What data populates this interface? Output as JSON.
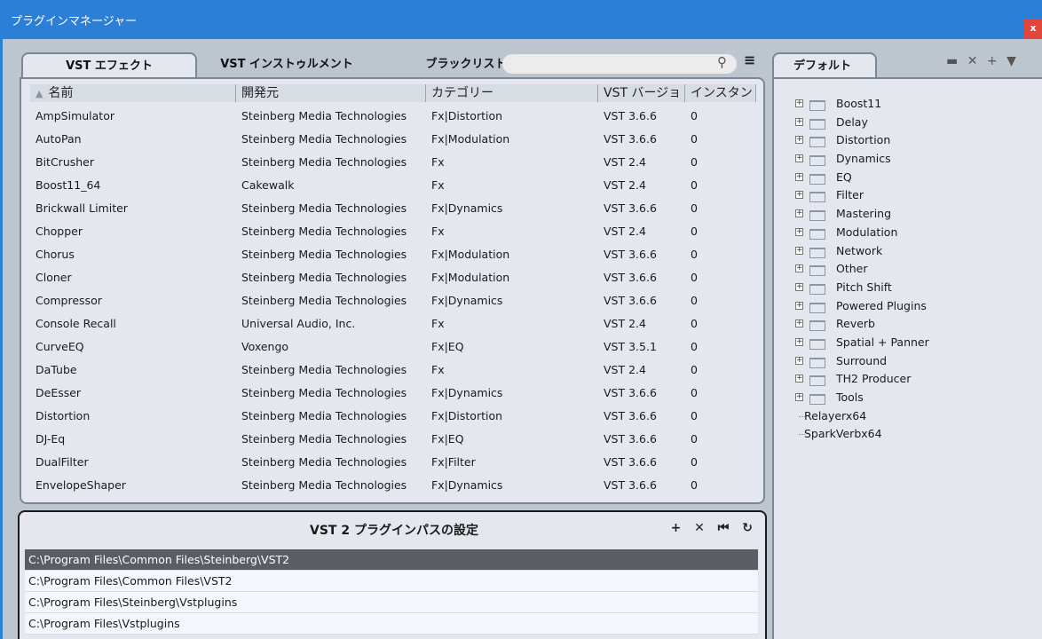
{
  "window": {
    "title": "プラグインマネージャー",
    "close_label": "x"
  },
  "tabs": [
    {
      "label": "VST エフェクト"
    },
    {
      "label": "VST インストゥルメント"
    },
    {
      "label": "ブラックリスト"
    }
  ],
  "table": {
    "columns": [
      "名前",
      "開発元",
      "カテゴリー",
      "VST バージョ",
      "インスタン"
    ],
    "rows": [
      [
        "AmpSimulator",
        "Steinberg Media Technologies",
        "Fx|Distortion",
        "VST 3.6.6",
        "0"
      ],
      [
        "AutoPan",
        "Steinberg Media Technologies",
        "Fx|Modulation",
        "VST 3.6.6",
        "0"
      ],
      [
        "BitCrusher",
        "Steinberg Media Technologies",
        "Fx",
        "VST 2.4",
        "0"
      ],
      [
        "Boost11_64",
        "Cakewalk",
        "Fx",
        "VST 2.4",
        "0"
      ],
      [
        "Brickwall Limiter",
        "Steinberg Media Technologies",
        "Fx|Dynamics",
        "VST 3.6.6",
        "0"
      ],
      [
        "Chopper",
        "Steinberg Media Technologies",
        "Fx",
        "VST 2.4",
        "0"
      ],
      [
        "Chorus",
        "Steinberg Media Technologies",
        "Fx|Modulation",
        "VST 3.6.6",
        "0"
      ],
      [
        "Cloner",
        "Steinberg Media Technologies",
        "Fx|Modulation",
        "VST 3.6.6",
        "0"
      ],
      [
        "Compressor",
        "Steinberg Media Technologies",
        "Fx|Dynamics",
        "VST 3.6.6",
        "0"
      ],
      [
        "Console Recall",
        "Universal Audio, Inc.",
        "Fx",
        "VST 2.4",
        "0"
      ],
      [
        "CurveEQ",
        "Voxengo",
        "Fx|EQ",
        "VST 3.5.1",
        "0"
      ],
      [
        "DaTube",
        "Steinberg Media Technologies",
        "Fx",
        "VST 2.4",
        "0"
      ],
      [
        "DeEsser",
        "Steinberg Media Technologies",
        "Fx|Dynamics",
        "VST 3.6.6",
        "0"
      ],
      [
        "Distortion",
        "Steinberg Media Technologies",
        "Fx|Distortion",
        "VST 3.6.6",
        "0"
      ],
      [
        "DJ-Eq",
        "Steinberg Media Technologies",
        "Fx|EQ",
        "VST 3.6.6",
        "0"
      ],
      [
        "DualFilter",
        "Steinberg Media Technologies",
        "Fx|Filter",
        "VST 3.6.6",
        "0"
      ],
      [
        "EnvelopeShaper",
        "Steinberg Media Technologies",
        "Fx|Dynamics",
        "VST 3.6.6",
        "0"
      ]
    ]
  },
  "paths": {
    "title": "VST 2 プラグインパスの設定",
    "items": [
      "C:\\Program Files\\Common Files\\Steinberg\\VST2",
      "C:\\Program Files\\Common Files\\VST2",
      "C:\\Program Files\\Steinberg\\Vstplugins",
      "C:\\Program Files\\Vstplugins"
    ]
  },
  "right": {
    "tab_label": "デフォルト",
    "folders": [
      "Boost11",
      "Delay",
      "Distortion",
      "Dynamics",
      "EQ",
      "Filter",
      "Mastering",
      "Modulation",
      "Network",
      "Other",
      "Pitch Shift",
      "Powered Plugins",
      "Reverb",
      "Spatial + Panner",
      "Surround",
      "TH2 Producer",
      "Tools"
    ],
    "leaves": [
      "Relayerx64",
      "SparkVerbx64"
    ]
  },
  "colors": {
    "accent": "#2c7fd6",
    "selected_row": "#5a5e64",
    "close": "#e0463b"
  }
}
